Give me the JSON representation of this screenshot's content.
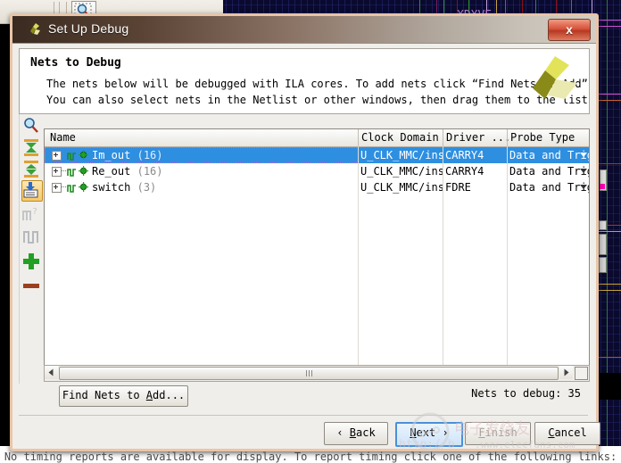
{
  "window": {
    "title": "Set Up Debug",
    "close_label": "x",
    "logo": "xilinx-logo"
  },
  "header": {
    "heading": "Nets to Debug",
    "line1": "The nets below will be debugged with ILA cores.  To add nets click “Find Nets to Add”.",
    "line2": "You can also select nets in the Netlist or other windows,  then drag them to the list or"
  },
  "left_toolbar": {
    "items": [
      {
        "icon": "search-icon",
        "enabled": true
      },
      {
        "icon": "collapse-all-icon",
        "enabled": true
      },
      {
        "icon": "expand-all-icon",
        "enabled": true
      },
      {
        "icon": "select-nets-icon",
        "enabled": true,
        "selected": true
      },
      {
        "icon": "unknown-probe-icon",
        "enabled": false
      },
      {
        "icon": "waveform-icon",
        "enabled": false
      },
      {
        "icon": "add-icon",
        "enabled": true
      },
      {
        "icon": "remove-icon",
        "enabled": true
      }
    ]
  },
  "table": {
    "columns": [
      "Name",
      "Clock Domain",
      "Driver ...",
      "Probe Type"
    ],
    "rows": [
      {
        "name": "Im_out",
        "count": "(16)",
        "clock_domain": "U_CLK_MMC/ins...",
        "driver": "CARRY4",
        "probe_type": "Data and Trigger",
        "selected": true
      },
      {
        "name": "Re_out",
        "count": "(16)",
        "clock_domain": "U_CLK_MMC/ins...",
        "driver": "CARRY4",
        "probe_type": "Data and Trigger",
        "selected": false
      },
      {
        "name": "switch",
        "count": "(3)",
        "clock_domain": "U_CLK_MMC/ins...",
        "driver": "FDRE",
        "probe_type": "Data and Trigger",
        "selected": false
      }
    ]
  },
  "actions": {
    "find_nets": "Find Nets to Add...",
    "nets_to_debug": "Nets to debug: 35"
  },
  "footer": {
    "back": "‹ Back",
    "next": "Next ›",
    "finish": "Finish",
    "cancel": "Cancel"
  },
  "status": {
    "message": "No timing reports are available for display. To report timing click one of the following links:"
  },
  "colors": {
    "accent_selection": "#2e8fe0",
    "dialog_border": "#e8c5a8",
    "title_dark": "#3a2a20",
    "close_red": "#d8523a",
    "logo_yellow": "#e3e35a",
    "logo_olive": "#8a8a18",
    "device_bg": "#0a0a2e"
  }
}
